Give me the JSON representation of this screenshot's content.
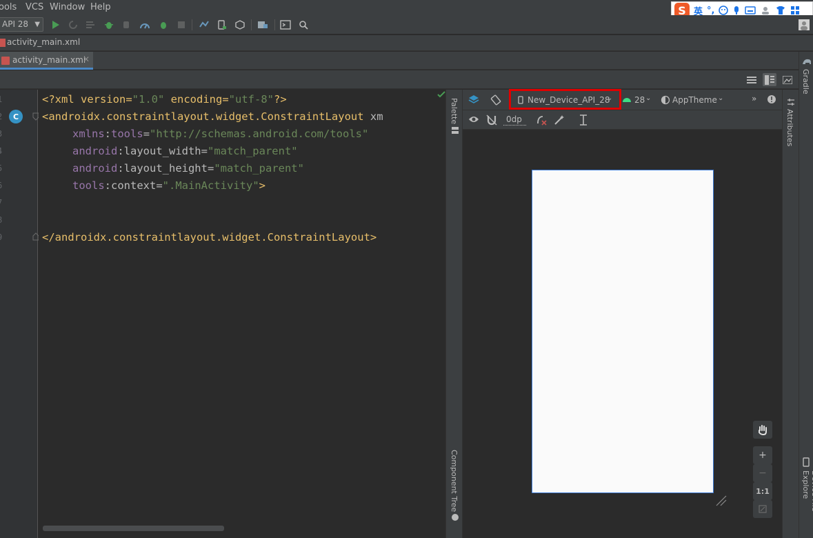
{
  "menubar": {
    "items": [
      "ools",
      "VCS",
      "Window",
      "Help"
    ],
    "ime": {
      "mode_label": "英",
      "punct": "°,"
    }
  },
  "toolbar": {
    "api_combo": "API 28"
  },
  "navbar": {
    "breadcrumb": "activity_main.xml"
  },
  "tabs": [
    {
      "label": "activity_main.xml",
      "active": true
    }
  ],
  "editor": {
    "line_numbers": [
      "1",
      "2",
      "3",
      "4",
      "5",
      "6",
      "7",
      "8",
      "9"
    ],
    "lines": {
      "l1_open": "<?xml version=",
      "l1_v": "\"1.0\"",
      "l1_enc": " encoding=",
      "l1_encv": "\"utf-8\"",
      "l1_close": "?>",
      "l2_tag": "<androidx.constraintlayout.widget.ConstraintLayout",
      "l2_attr": " xm",
      "l3_ns": "xmlns",
      "l3_colon": ":",
      "l3_name": "tools",
      "l3_eq": "=",
      "l3_val": "\"http://schemas.android.com/tools\"",
      "l4_ns": "android",
      "l4_name": ":layout_width=",
      "l4_val": "\"match_parent\"",
      "l5_ns": "android",
      "l5_name": ":layout_height=",
      "l5_val": "\"match_parent\"",
      "l6_ns": "tools",
      "l6_name": ":context=",
      "l6_val": "\".MainActivity\"",
      "l6_close": ">",
      "l9_tag": "</androidx.constraintlayout.widget.ConstraintLayout>"
    },
    "gutter_badge": "C"
  },
  "side_panels": {
    "palette": "Palette",
    "component_tree": "Component Tree",
    "attributes": "Attributes",
    "gradle": "Gradle",
    "device_file_explorer": "Device File Explore"
  },
  "design": {
    "device": "New_Device_API_28",
    "api_level": "28",
    "theme": "AppTheme",
    "margin": "0dp",
    "zoom_fit_label": "1:1"
  },
  "colors": {
    "highlight": "#e00000",
    "accent": "#4a88c7",
    "android_green": "#3ddc84"
  }
}
